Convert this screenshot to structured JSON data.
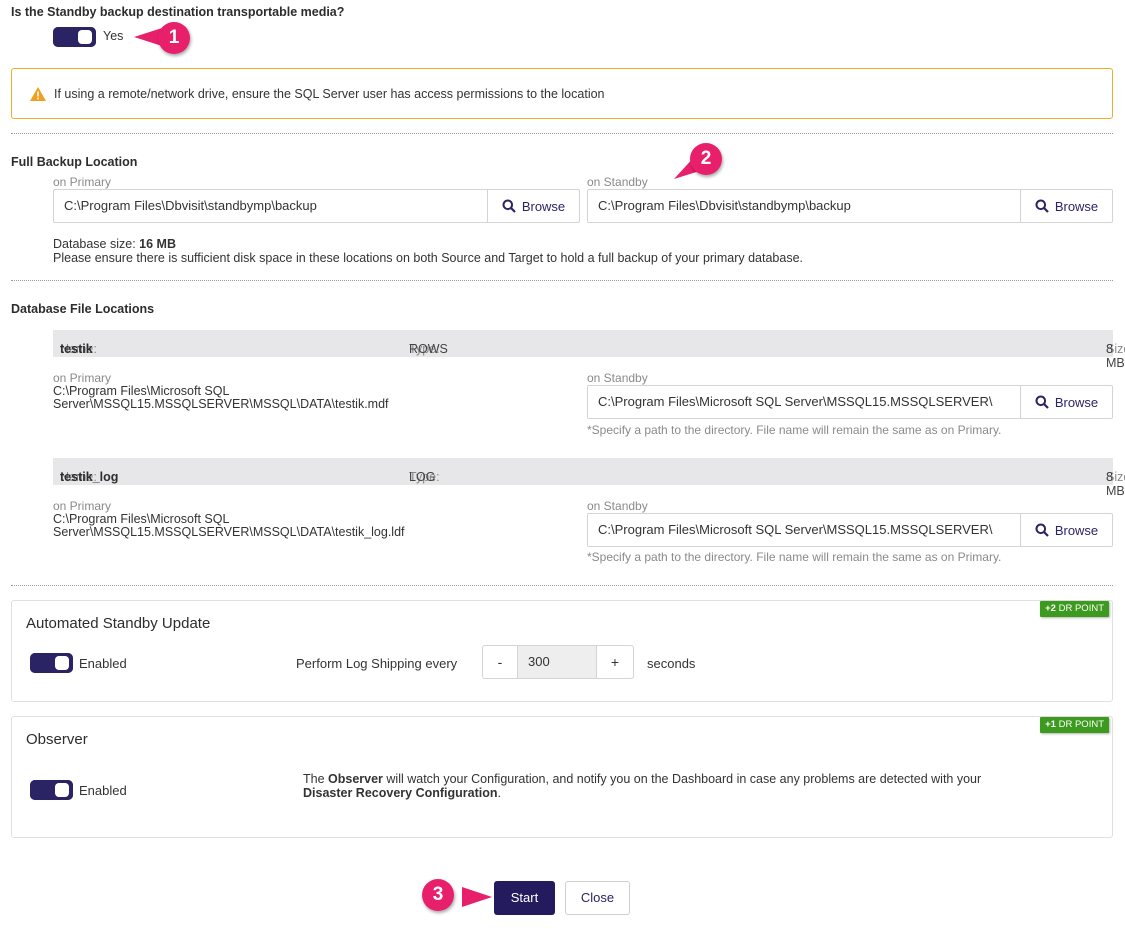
{
  "transportable": {
    "question": "Is the Standby backup destination transportable media?",
    "toggle_label": "Yes"
  },
  "markers": [
    "1",
    "2",
    "3"
  ],
  "warning": {
    "text": "If using a remote/network drive, ensure the SQL Server user has access permissions to the location",
    "color": "#f0ad2c"
  },
  "full_backup": {
    "title": "Full Backup Location",
    "primary_label": "on Primary",
    "primary_path": "C:\\Program Files\\Dbvisit\\standbymp\\backup",
    "standby_label": "on Standby",
    "standby_path": "C:\\Program Files\\Dbvisit\\standbymp\\backup",
    "browse_label": "Browse",
    "db_size_label": "Database size:",
    "db_size_value": "16 MB",
    "note": "Please ensure there is sufficient disk space in these locations on both Source and Target to hold a full backup of your primary database."
  },
  "db_files": {
    "title": "Database File Locations",
    "name_label": "Name:",
    "type_label": "Type:",
    "size_label": "Size:",
    "primary_label": "on Primary",
    "standby_label": "on Standby",
    "browse_label": "Browse",
    "hint": "*Specify a path to the directory. File name will remain the same as on Primary.",
    "files": [
      {
        "name": "testik",
        "type": "ROWS",
        "size": "8 MB",
        "primary_line1": "C:\\Program Files\\Microsoft SQL",
        "primary_line2": "Server\\MSSQL15.MSSQLSERVER\\MSSQL\\DATA\\testik.mdf",
        "standby_path": "C:\\Program Files\\Microsoft SQL Server\\MSSQL15.MSSQLSERVER\\"
      },
      {
        "name": "testik_log",
        "type": "LOG",
        "size": "8 MB",
        "primary_line1": "C:\\Program Files\\Microsoft SQL",
        "primary_line2": "Server\\MSSQL15.MSSQLSERVER\\MSSQL\\DATA\\testik_log.ldf",
        "standby_path": "C:\\Program Files\\Microsoft SQL Server\\MSSQL15.MSSQLSERVER\\"
      }
    ]
  },
  "automated_update": {
    "title": "Automated Standby Update",
    "badge_value": "+2",
    "badge_text": "DR POINT",
    "toggle_label": "Enabled",
    "shipping_label": "Perform Log Shipping every",
    "minus": "-",
    "plus": "+",
    "interval": "300",
    "unit": "seconds"
  },
  "observer": {
    "title": "Observer",
    "badge_value": "+1",
    "badge_text": "DR POINT",
    "toggle_label": "Enabled",
    "desc_part1": "The ",
    "desc_bold1": "Observer",
    "desc_part2": " will watch your Configuration, and notify you on the Dashboard in case any problems are detected with your",
    "desc_bold2": "Disaster Recovery Configuration",
    "desc_part3": "."
  },
  "actions": {
    "start": "Start",
    "close": "Close"
  },
  "colors": {
    "primary": "#2b2464",
    "accent_marker": "#e8206b",
    "badge_green": "#3c9a1f"
  }
}
